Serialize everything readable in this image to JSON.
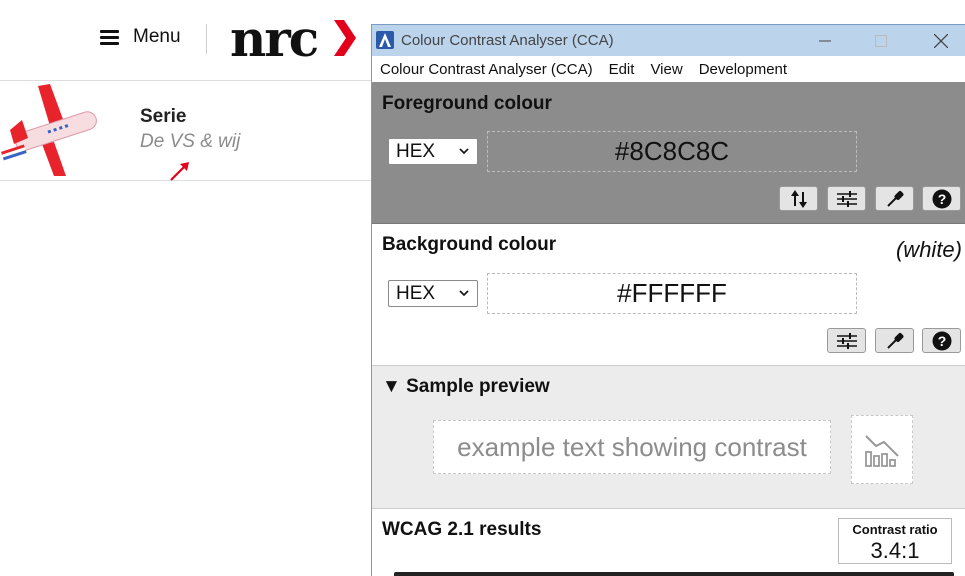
{
  "nrc": {
    "menu_label": "Menu",
    "logo_text": "nrc",
    "serie_label": "Serie",
    "serie_subtitle": "De VS & wij"
  },
  "cca": {
    "title": "Colour Contrast Analyser (CCA)",
    "menu": [
      "Colour Contrast Analyser (CCA)",
      "Edit",
      "View",
      "Development"
    ],
    "foreground": {
      "heading": "Foreground colour",
      "format": "HEX",
      "value": "#8C8C8C"
    },
    "background": {
      "heading": "Background colour",
      "format": "HEX",
      "value": "#FFFFFF",
      "name": "(white)"
    },
    "preview": {
      "heading": "▼ Sample preview",
      "sample_text": "example text showing contrast"
    },
    "results": {
      "heading": "WCAG 2.1 results",
      "ratio_label": "Contrast ratio",
      "ratio_value": "3.4:1"
    }
  },
  "colors": {
    "foreground": "#8C8C8C",
    "background": "#FFFFFF",
    "titlebar": "#BCD3EC",
    "nrc_red": "#E3001B"
  }
}
